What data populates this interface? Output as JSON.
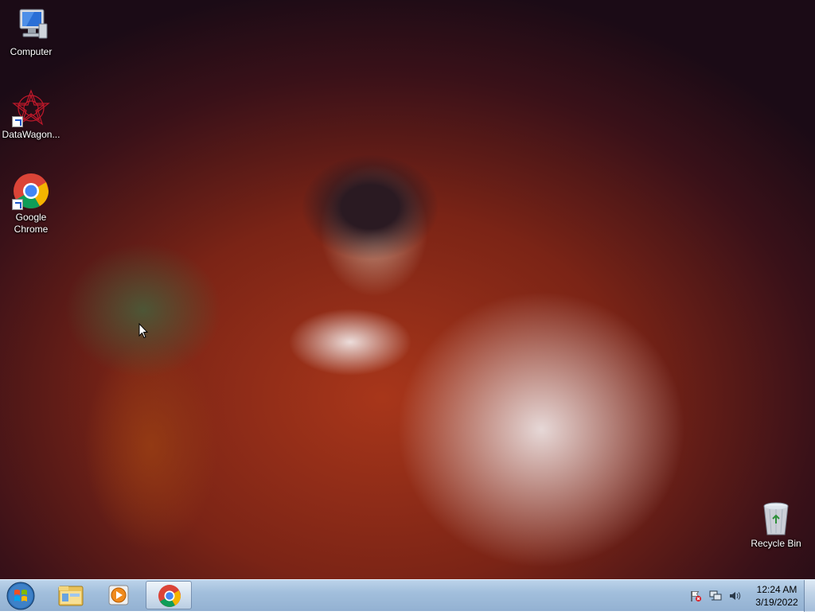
{
  "desktop": {
    "icons": [
      {
        "label": "Computer",
        "icon": "computer-icon"
      },
      {
        "label": "DataWagon...",
        "icon": "datawagon-icon"
      },
      {
        "label": "Google Chrome",
        "icon": "chrome-icon"
      },
      {
        "label": "Recycle Bin",
        "icon": "recycle-bin-icon"
      }
    ]
  },
  "taskbar": {
    "start_icon": "windows-start-icon",
    "pinned": [
      {
        "name": "file-explorer",
        "icon": "folder-icon"
      },
      {
        "name": "media-player",
        "icon": "media-player-icon"
      },
      {
        "name": "google-chrome",
        "icon": "chrome-icon",
        "active": true
      }
    ],
    "tray": {
      "icons": [
        "action-center-flag-icon",
        "network-icon",
        "volume-icon"
      ],
      "time": "12:24 AM",
      "date": "3/19/2022"
    }
  },
  "colors": {
    "taskbar": "#a2bfdc",
    "chrome_red": "#db4437",
    "chrome_green": "#0f9d58",
    "chrome_yellow": "#f4b400",
    "chrome_blue": "#4285f4"
  }
}
